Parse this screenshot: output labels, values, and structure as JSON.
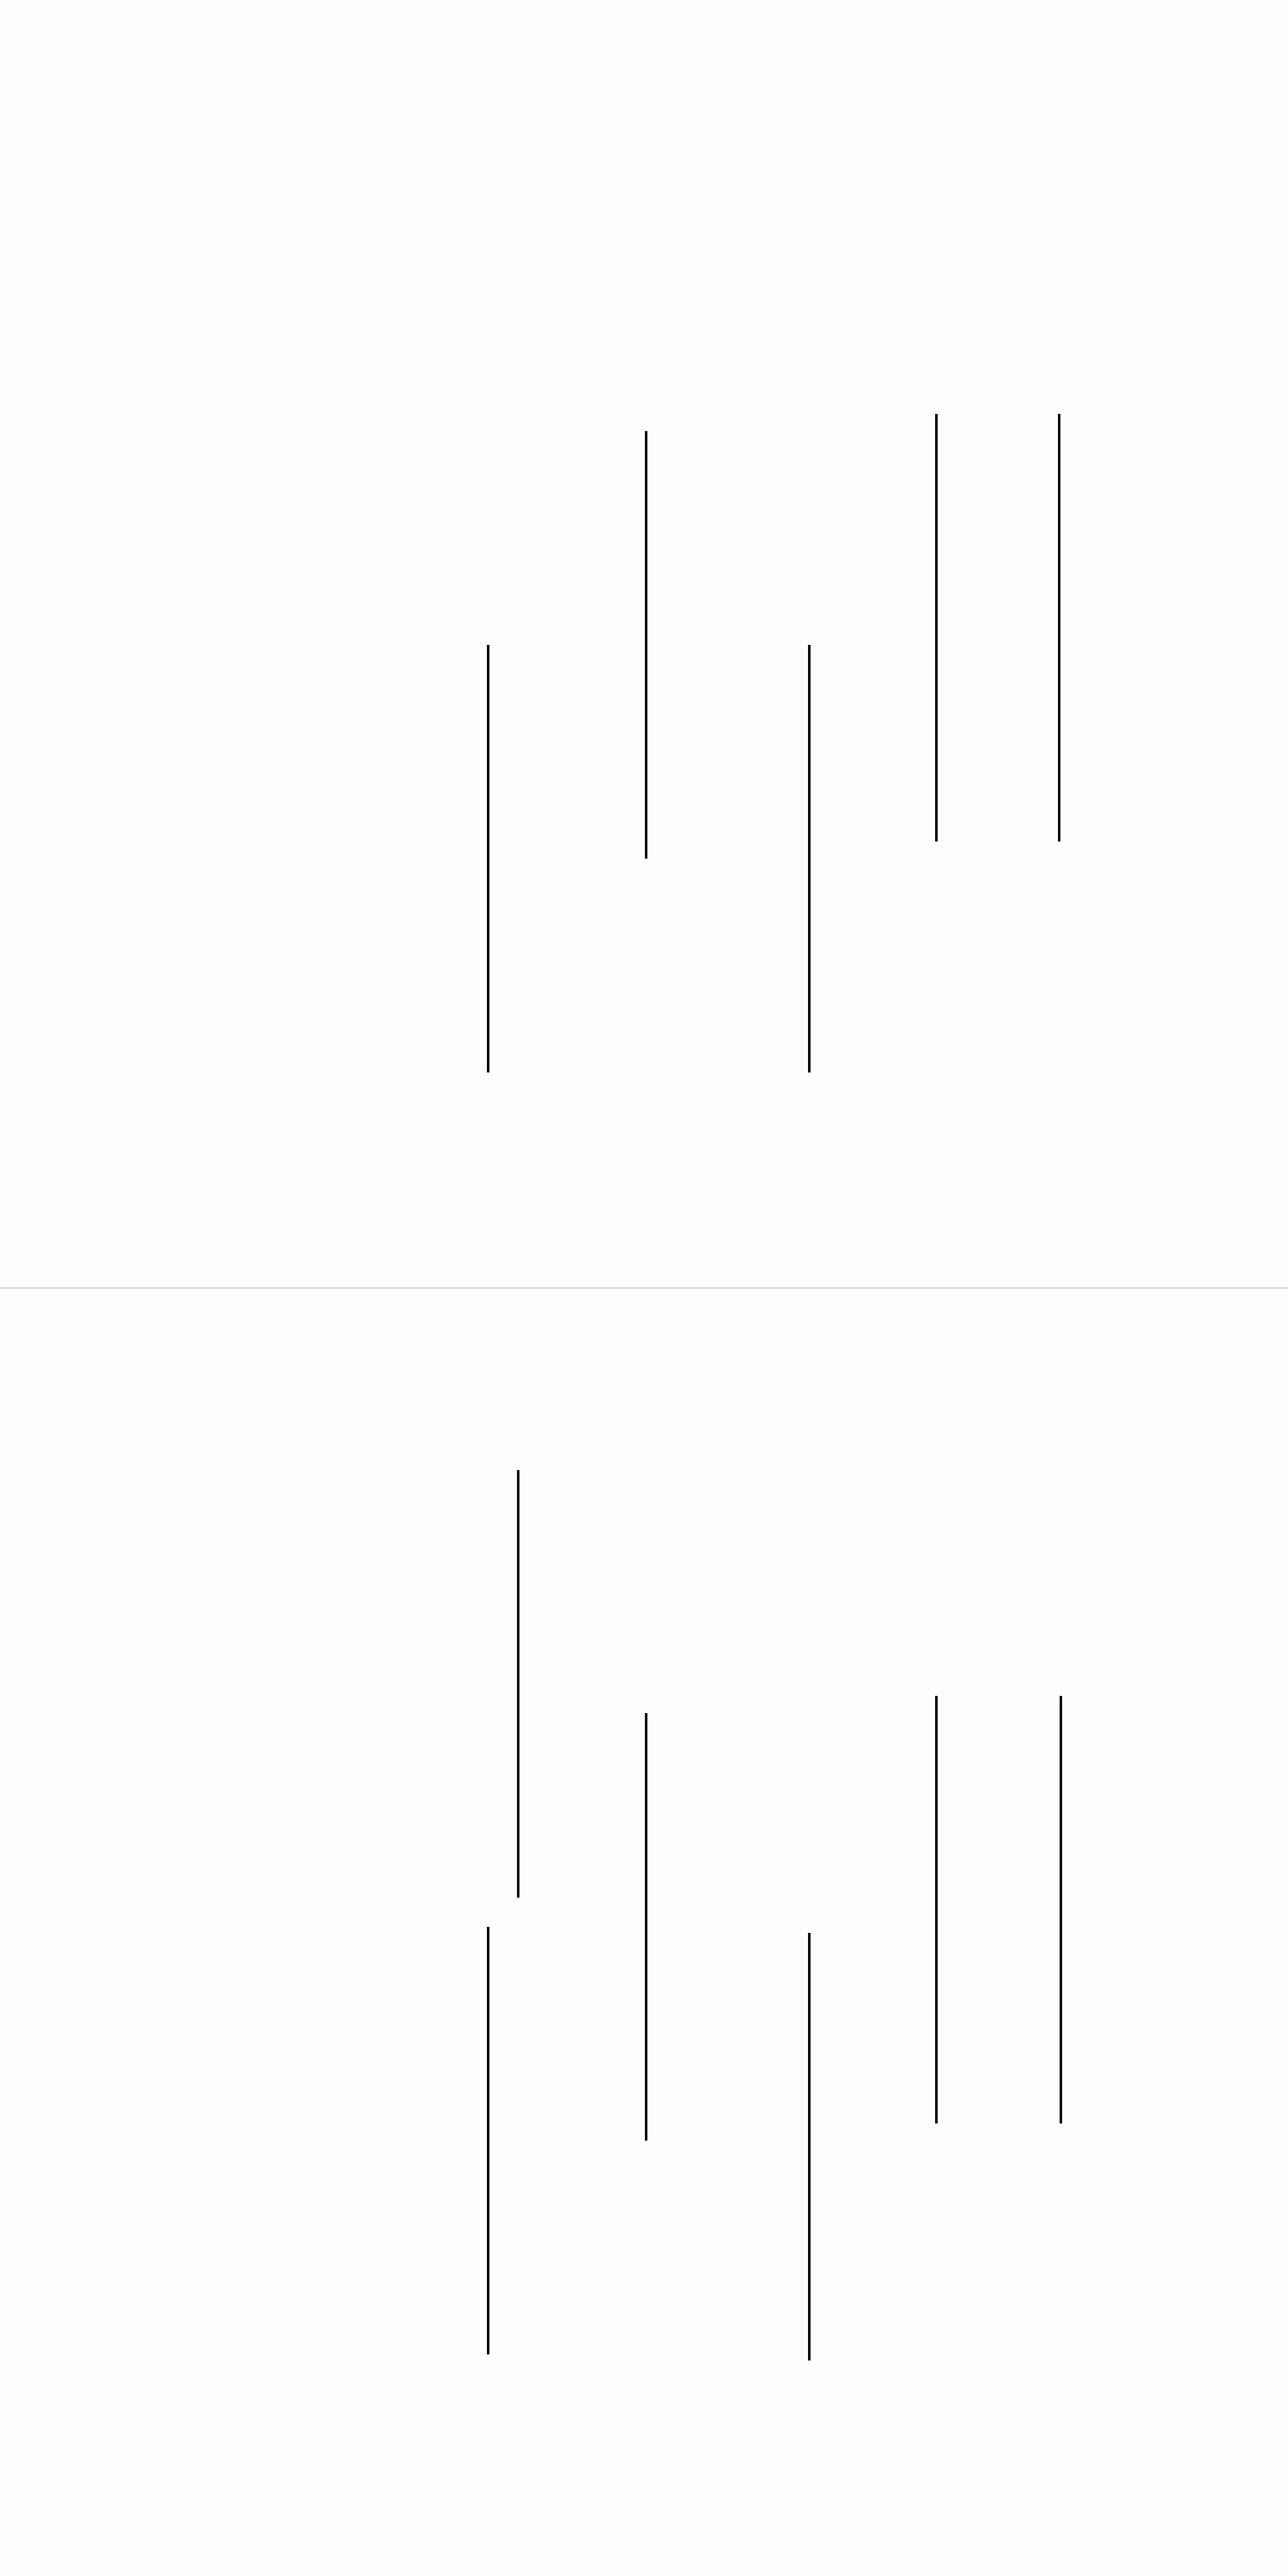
{
  "panels": [
    {
      "name": "top",
      "stroke_count": 5
    },
    {
      "name": "bottom",
      "stroke_count": 6
    }
  ],
  "colors": {
    "background": "#fdfdfd",
    "stroke": "#111111",
    "divider": "#d9d9d9"
  }
}
